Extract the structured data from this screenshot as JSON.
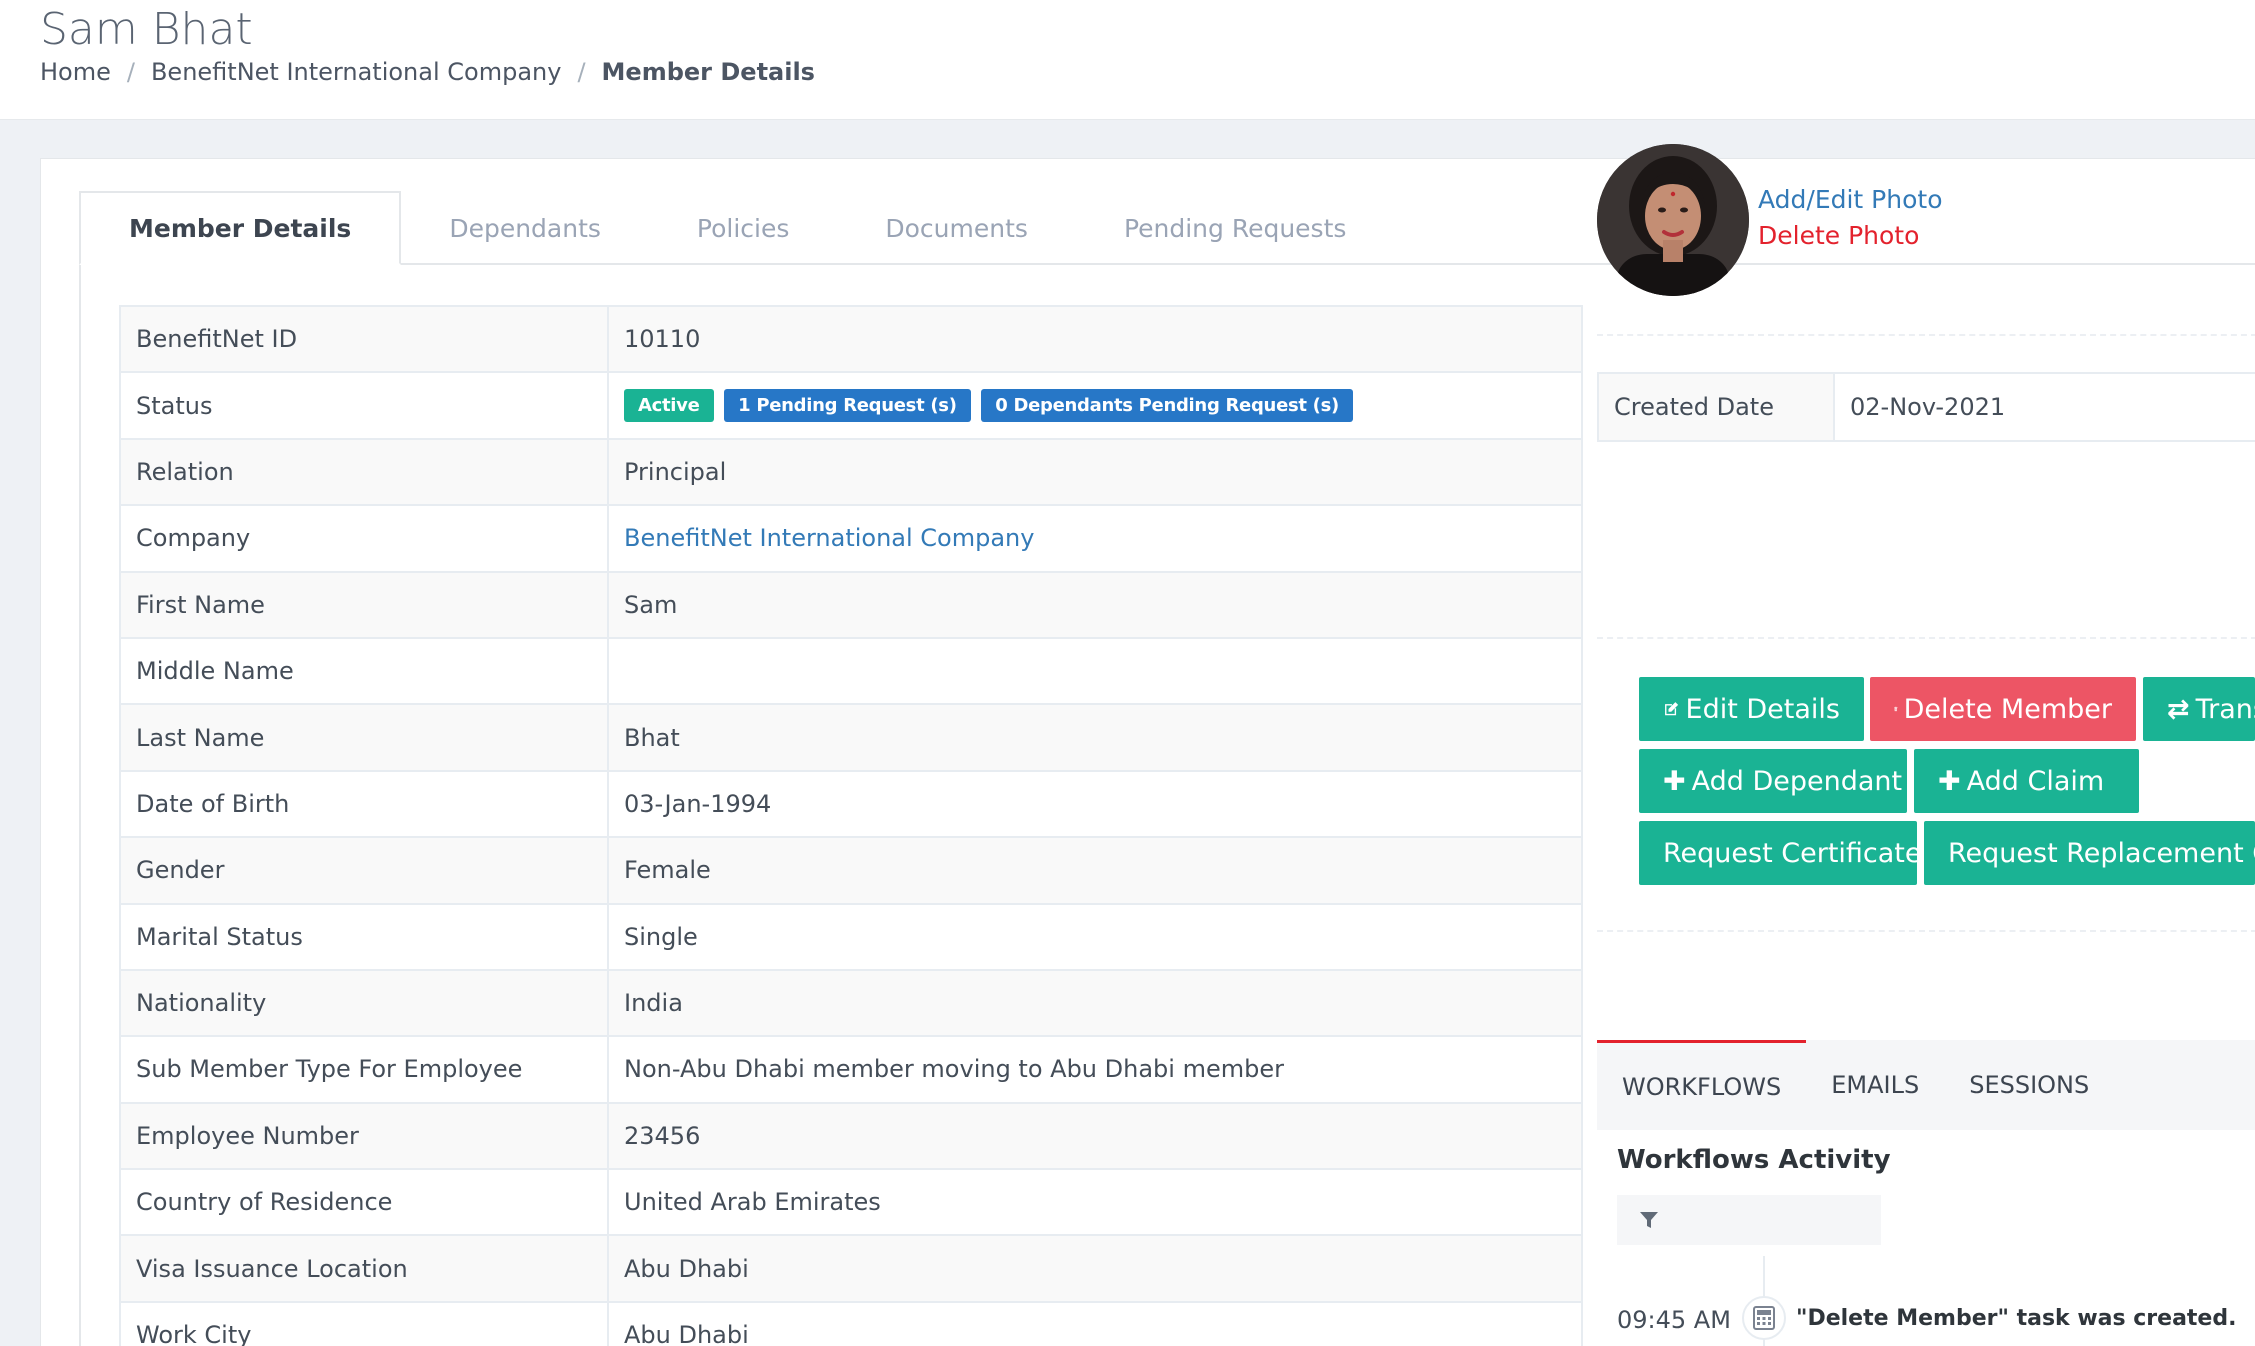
{
  "header": {
    "title": "Sam Bhat",
    "breadcrumb": [
      "Home",
      "BenefitNet International Company",
      "Member Details"
    ]
  },
  "tabs": [
    "Member Details",
    "Dependants",
    "Policies",
    "Documents",
    "Pending Requests"
  ],
  "details": {
    "rows": [
      {
        "label": "BenefitNet ID",
        "value": "10110"
      },
      {
        "label": "Status",
        "value": ""
      },
      {
        "label": "Relation",
        "value": "Principal"
      },
      {
        "label": "Company",
        "value": "BenefitNet International Company"
      },
      {
        "label": "First Name",
        "value": "Sam"
      },
      {
        "label": "Middle Name",
        "value": ""
      },
      {
        "label": "Last Name",
        "value": "Bhat"
      },
      {
        "label": "Date of Birth",
        "value": "03-Jan-1994"
      },
      {
        "label": "Gender",
        "value": "Female"
      },
      {
        "label": "Marital Status",
        "value": "Single"
      },
      {
        "label": "Nationality",
        "value": "India"
      },
      {
        "label": "Sub Member Type For Employee",
        "value": "Non-Abu Dhabi member moving to Abu Dhabi member"
      },
      {
        "label": "Employee Number",
        "value": "23456"
      },
      {
        "label": "Country of Residence",
        "value": "United Arab Emirates"
      },
      {
        "label": "Visa Issuance Location",
        "value": "Abu Dhabi"
      },
      {
        "label": "Work City",
        "value": "Abu Dhabi"
      }
    ],
    "status_badges": {
      "active": "Active",
      "pending": "1 Pending Request (s)",
      "dependants_pending": "0 Dependants Pending Request (s)"
    }
  },
  "photo": {
    "add_edit": "Add/Edit Photo",
    "delete": "Delete Photo"
  },
  "created": {
    "label": "Created Date",
    "value": "02-Nov-2021"
  },
  "actions": {
    "edit": "Edit Details",
    "delete": "Delete Member",
    "transfer": "Trans",
    "add_dependant": "Add Dependant",
    "add_claim": "Add Claim",
    "request_certificate": "Request Certificate",
    "request_replacement": "Request Replacement Ca"
  },
  "activity": {
    "tabs": [
      "WORKFLOWS",
      "EMAILS",
      "SESSIONS"
    ],
    "title": "Workflows Activity",
    "items": [
      {
        "time": "09:45 AM",
        "text": "\"Delete Member\" task was created."
      }
    ]
  },
  "colors": {
    "primary": "#1ab394",
    "danger": "#ed5565",
    "link": "#337ab7",
    "badge_blue": "#2777c7"
  }
}
